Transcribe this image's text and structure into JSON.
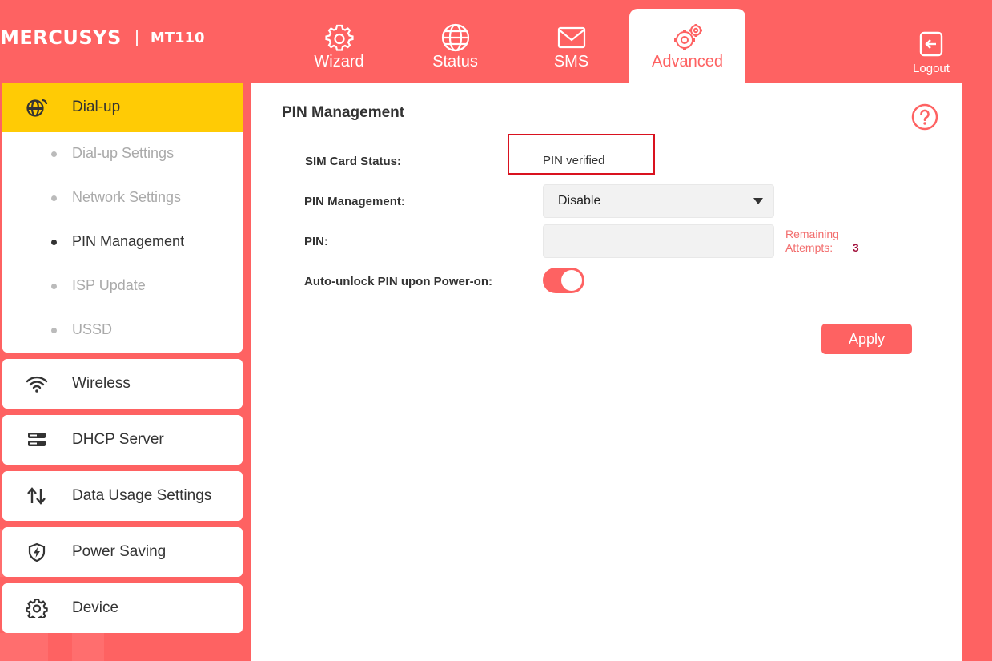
{
  "header": {
    "brand": "MERCUSYS",
    "model": "MT110",
    "tabs": [
      {
        "label": "Wizard",
        "icon": "gear-icon"
      },
      {
        "label": "Status",
        "icon": "globe-icon"
      },
      {
        "label": "SMS",
        "icon": "envelope-icon"
      },
      {
        "label": "Advanced",
        "icon": "gears-icon",
        "active": true
      }
    ],
    "logout_label": "Logout"
  },
  "sidebar": {
    "dialup": {
      "label": "Dial-up",
      "icon": "globe-signal-icon",
      "items": [
        {
          "label": "Dial-up Settings"
        },
        {
          "label": "Network Settings"
        },
        {
          "label": "PIN Management",
          "current": true
        },
        {
          "label": "ISP Update"
        },
        {
          "label": "USSD"
        }
      ]
    },
    "sections": [
      {
        "label": "Wireless",
        "icon": "wifi-icon"
      },
      {
        "label": "DHCP Server",
        "icon": "server-icon"
      },
      {
        "label": "Data Usage Settings",
        "icon": "up-down-arrows-icon"
      },
      {
        "label": "Power Saving",
        "icon": "shield-bolt-icon"
      },
      {
        "label": "Device",
        "icon": "gear-icon"
      }
    ]
  },
  "main": {
    "title": "PIN Management",
    "fields": {
      "sim_status_label": "SIM Card Status:",
      "sim_status_value": "PIN verified",
      "pin_mgmt_label": "PIN Management:",
      "pin_mgmt_value": "Disable",
      "pin_label": "PIN:",
      "pin_value": "",
      "remaining_text": "Remaining Attempts:",
      "remaining_count": "3",
      "auto_unlock_label": "Auto-unlock PIN upon Power-on:",
      "auto_unlock_on": true
    },
    "apply_label": "Apply"
  },
  "colors": {
    "primary": "#fe6262",
    "active_nav": "#ffcb05",
    "highlight_box": "#d9121f",
    "remaining_count": "#a3153f"
  }
}
